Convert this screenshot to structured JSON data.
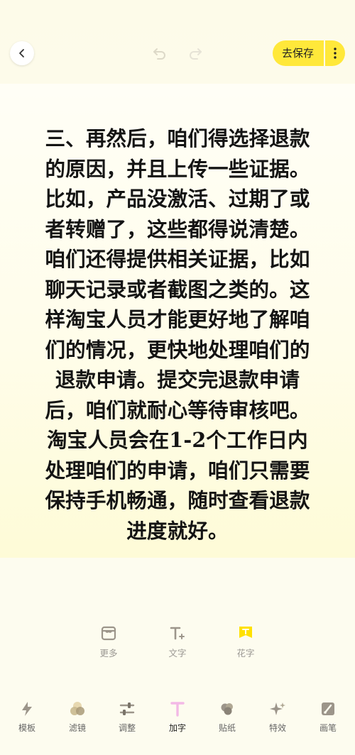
{
  "header": {
    "back_icon": "chevron-left-icon",
    "undo_icon": "undo-icon",
    "redo_icon": "redo-icon",
    "save_label": "去保存",
    "more_icon": "vertical-dots-icon",
    "accent_color": "#ffe83a"
  },
  "canvas": {
    "text": "三、再然后，咱们得选择退款的原因，并且上传一些证据。比如，产品没激活、过期了或者转赠了，这些都得说清楚。咱们还得提供相关证据，比如聊天记录或者截图之类的。这样淘宝人员才能更好地了解咱们的情况，更快地处理咱们的退款申请。提交完退款申请后，咱们就耐心等待审核吧。淘宝人员会在1-2个工作日内处理咱们的申请，咱们只需要保持手机畅通，随时查看退款进度就好。"
  },
  "sub_tools": [
    {
      "label": "更多",
      "icon": "store-icon"
    },
    {
      "label": "文字",
      "icon": "text-add-icon"
    },
    {
      "label": "花字",
      "icon": "fancy-text-icon"
    }
  ],
  "main_tools": [
    {
      "label": "模板",
      "icon": "lightning-icon"
    },
    {
      "label": "滤镜",
      "icon": "filter-circles-icon"
    },
    {
      "label": "调整",
      "icon": "sliders-icon"
    },
    {
      "label": "加字",
      "icon": "text-icon"
    },
    {
      "label": "贴纸",
      "icon": "sticker-icon"
    },
    {
      "label": "特效",
      "icon": "sparkle-icon"
    },
    {
      "label": "画笔",
      "icon": "brush-icon"
    }
  ]
}
